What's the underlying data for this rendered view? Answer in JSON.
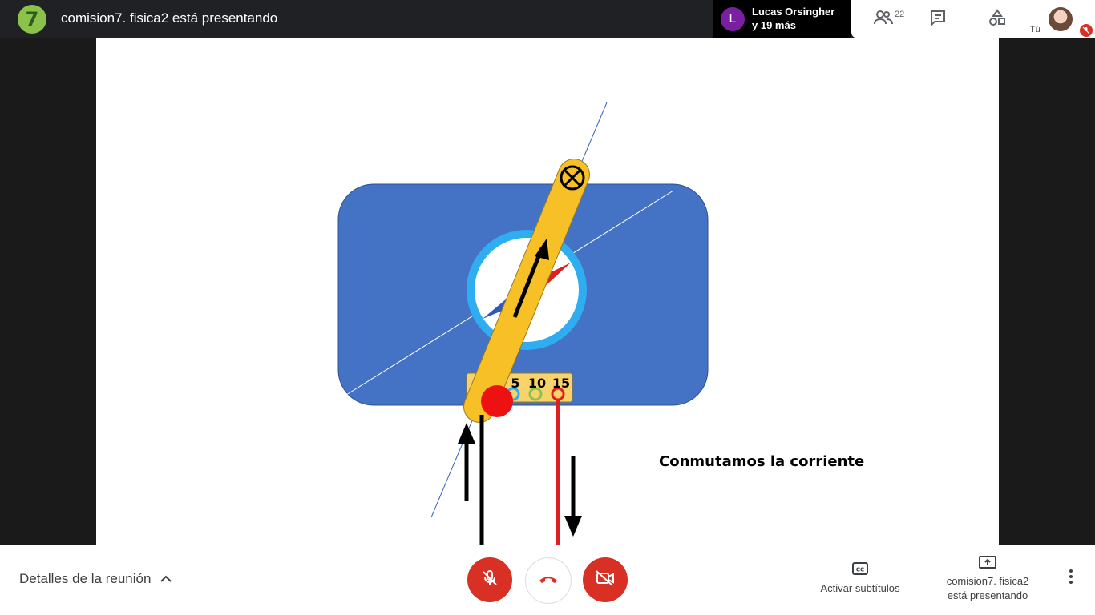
{
  "header": {
    "logo_text": "7",
    "title": "comision7. fisica2 está presentando",
    "participants": {
      "avatar_letter": "L",
      "line1": "Lucas Orsingher",
      "line2": "y 19 más"
    },
    "people_count": "22",
    "self_label": "Tú"
  },
  "icons": {
    "people": "people-icon",
    "chat": "chat-icon",
    "activities": "activities-icon",
    "mic_off": "mic-off-icon",
    "hangup": "hangup-icon",
    "camera_off": "camera-off-icon",
    "captions": "closed-captions-icon",
    "present": "present-screen-icon",
    "more": "more-vert-icon",
    "chevron": "chevron-up-icon"
  },
  "slide": {
    "caption": "Conmutamos la corriente",
    "scale_labels": [
      "5",
      "10",
      "15"
    ]
  },
  "controls": {
    "details": "Detalles de la reunión",
    "captions": "Activar subtítulos",
    "presenting_line1": "comision7. fisica2",
    "presenting_line2": "está presentando"
  },
  "colors": {
    "danger": "#d93025",
    "panel_blue": "#4472c4",
    "compass_ring": "#2eaef0",
    "needle_gold": "#f6c026"
  }
}
